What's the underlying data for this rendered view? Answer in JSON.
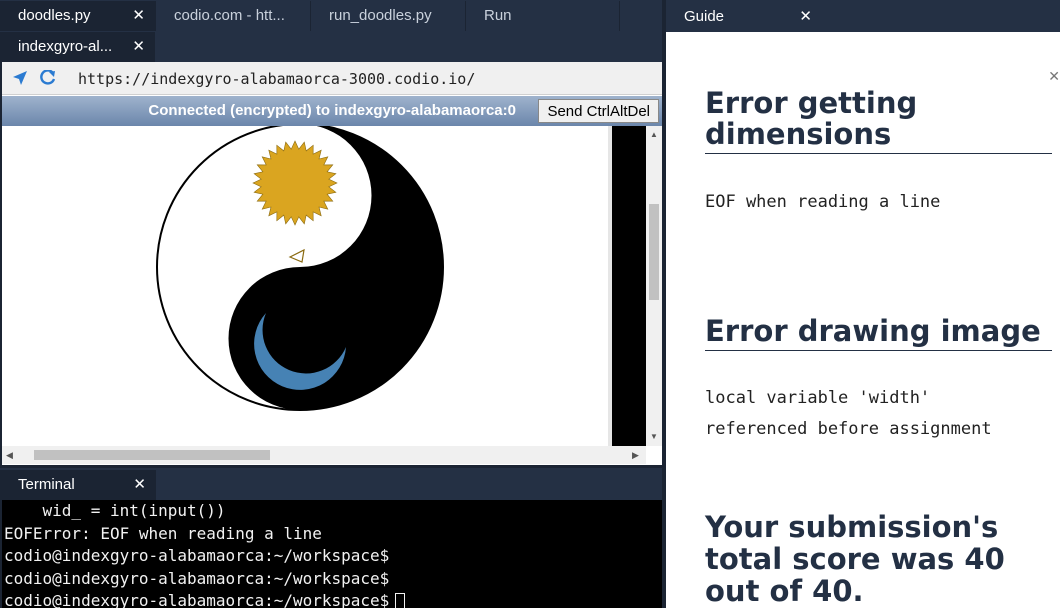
{
  "editor_tabs": {
    "row1": [
      {
        "label": "doodles.py",
        "close": "✕"
      },
      {
        "label": "codio.com - htt...",
        "close": ""
      },
      {
        "label": "run_doodles.py",
        "close": ""
      },
      {
        "label": "Run",
        "close": ""
      }
    ],
    "row2": [
      {
        "label": "indexgyro-al...",
        "close": "✕"
      }
    ]
  },
  "browser": {
    "url": "https://indexgyro-alabamaorca-3000.codio.io/",
    "status": "Connected (encrypted) to indexgyro-alabamaorca:0",
    "ctrl_button": "Send CtrlAltDel"
  },
  "terminal": {
    "tab_label": "Terminal",
    "close": "✕",
    "lines": [
      "    wid_ = int(input())",
      "EOFError: EOF when reading a line",
      "codio@indexgyro-alabamaorca:~/workspace$",
      "codio@indexgyro-alabamaorca:~/workspace$",
      "codio@indexgyro-alabamaorca:~/workspace$"
    ]
  },
  "guide": {
    "tab_label": "Guide",
    "close": "✕",
    "h1": "Error getting dimensions",
    "p1": "EOF when reading a line",
    "h2": "Error drawing image",
    "p2a": "local variable 'width'",
    "p2b": "referenced before assignment",
    "h3": "Your submission's total score was 40 out of 40."
  },
  "colors": {
    "sun": "#daa520",
    "moon": "#4682b4",
    "panel_bg": "#1b2433",
    "tabbar_bg": "#243044",
    "heading": "#233044"
  }
}
